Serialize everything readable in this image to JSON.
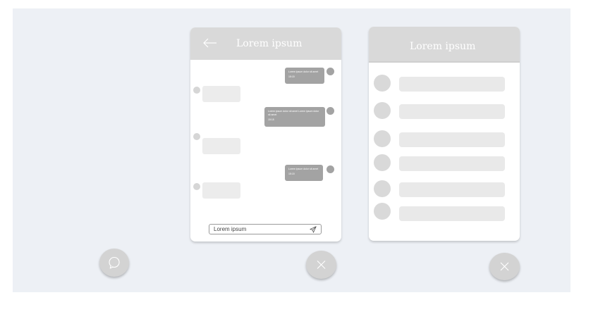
{
  "chat_panel": {
    "title": "Lorem ipsum",
    "messages_out": [
      {
        "text": "Lorem ipsum dolor sit amet",
        "time": "15:15"
      },
      {
        "text": "Lorem ipsum dolor sit amet Lorem ipsum dolor sit amet",
        "time": "15:15"
      },
      {
        "text": "Lorem ipsum dolor sit amet",
        "time": "15:15"
      }
    ],
    "input_placeholder": "Lorem ipsum"
  },
  "list_panel": {
    "title": "Lorem ipsum",
    "row_count": 6
  },
  "icons": {
    "back": "arrow-left-icon",
    "send": "send-icon",
    "chat_fab": "chat-bubble-icon",
    "close": "close-icon"
  },
  "colors": {
    "background": "#edf0f5",
    "header": "#d9d9d9",
    "outgoing_bubble": "#a3a3a3",
    "incoming_bubble": "#ececec",
    "fab": "#d3d3d3"
  }
}
